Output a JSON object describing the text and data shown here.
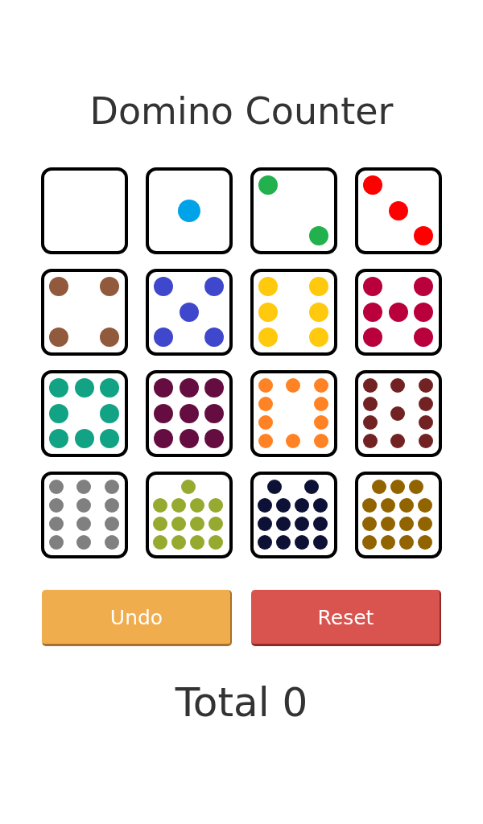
{
  "title": "Domino Counter",
  "tiles": [
    {
      "kind": "zero"
    },
    {
      "kind": "one",
      "color": "#00a2e8"
    },
    {
      "kind": "two",
      "color": "#22b14c"
    },
    {
      "kind": "three",
      "color": "#ff0000"
    },
    {
      "kind": "four",
      "color": "#915a3d"
    },
    {
      "kind": "five",
      "color": "#3f48cc"
    },
    {
      "kind": "six",
      "color": "#ffc90e"
    },
    {
      "kind": "seven",
      "color": "#b9003c"
    },
    {
      "kind": "eight",
      "color": "#12a384"
    },
    {
      "kind": "nine",
      "color": "#650d40"
    },
    {
      "kind": "ten",
      "color": "#ff8224"
    },
    {
      "kind": "eleven",
      "color": "#722222"
    },
    {
      "kind": "twelve",
      "color": "#808080"
    },
    {
      "kind": "thirteen",
      "color": "#95aa2f"
    },
    {
      "kind": "fourteen",
      "color": "#0e1136"
    },
    {
      "kind": "fifteen",
      "color": "#926400"
    }
  ],
  "buttons": [
    {
      "kind": "warning",
      "label": "Undo"
    },
    {
      "kind": "danger",
      "label": "Reset"
    }
  ],
  "total": "Total 0"
}
